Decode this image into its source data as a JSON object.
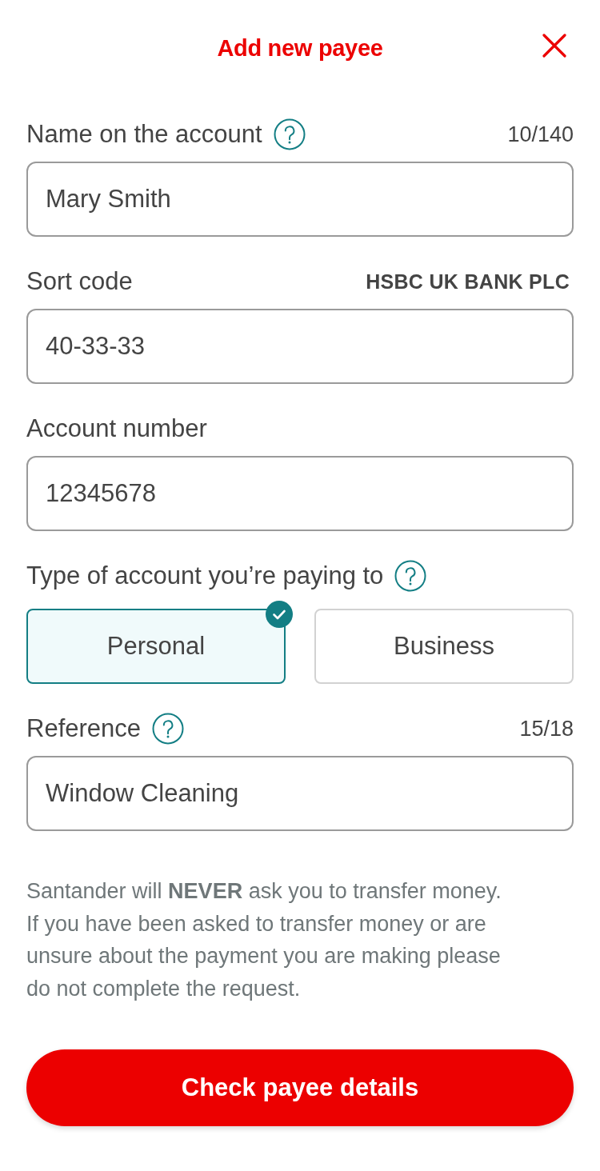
{
  "header": {
    "title": "Add new payee"
  },
  "fields": [
    {
      "kind": "text",
      "label": "Name on the account",
      "help": true,
      "counter": "10/140",
      "value": "Mary Smith"
    },
    {
      "kind": "text",
      "label": "Sort code",
      "help": false,
      "bank": "HSBC UK BANK PLC",
      "value": "40-33-33"
    },
    {
      "kind": "text",
      "label": "Account number",
      "help": false,
      "value": "12345678"
    },
    {
      "kind": "choice",
      "label": "Type of account you’re paying to",
      "help": true,
      "options": [
        {
          "label": "Personal",
          "selected": true
        },
        {
          "label": "Business",
          "selected": false
        }
      ]
    },
    {
      "kind": "text",
      "label": "Reference",
      "help": true,
      "counter": "15/18",
      "value": "Window Cleaning"
    }
  ],
  "notice": [
    "Santander will **NEVER** ask you to transfer money.",
    "If you have been asked to transfer money or are unsure about the payment you are making please do not complete the request."
  ],
  "button": {
    "label": "Check payee details"
  }
}
